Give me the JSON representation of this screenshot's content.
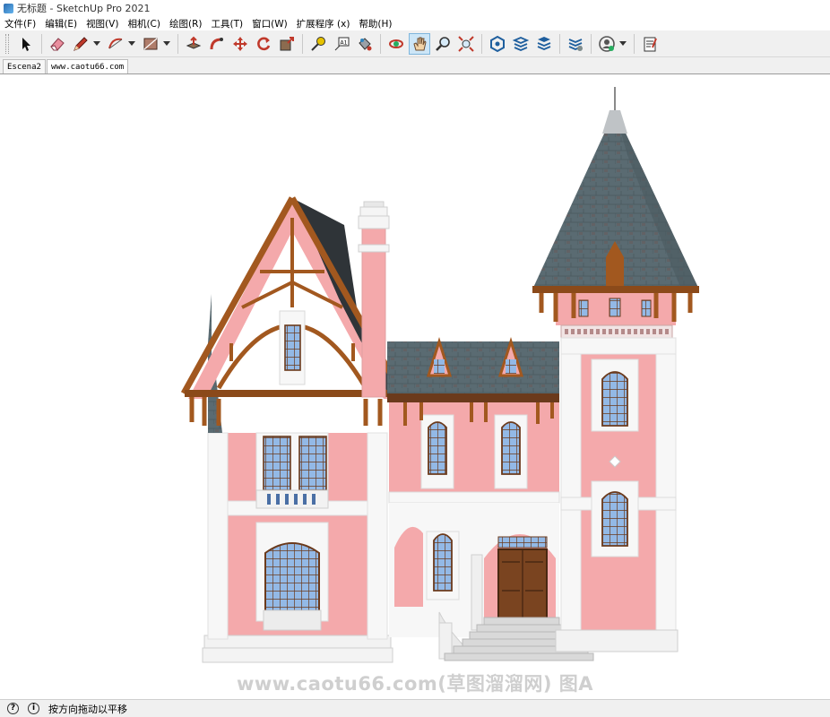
{
  "window": {
    "title": "无标题 - SketchUp Pro 2021"
  },
  "menu": [
    "文件(F)",
    "编辑(E)",
    "视图(V)",
    "相机(C)",
    "绘图(R)",
    "工具(T)",
    "窗口(W)",
    "扩展程序 (x)",
    "帮助(H)"
  ],
  "toolbar": {
    "groups": [
      [
        {
          "icon": "select-arrow-icon",
          "active": false
        }
      ],
      [
        {
          "icon": "eraser-icon"
        },
        {
          "icon": "pencil-line-icon",
          "dropdown": true
        },
        {
          "icon": "arc-icon",
          "dropdown": true
        },
        {
          "icon": "rectangle-icon",
          "dropdown": true
        }
      ],
      [
        {
          "icon": "push-pull-icon"
        },
        {
          "icon": "follow-me-icon"
        },
        {
          "icon": "move-icon"
        },
        {
          "icon": "rotate-icon"
        },
        {
          "icon": "scale-icon"
        }
      ],
      [
        {
          "icon": "tape-measure-icon"
        },
        {
          "icon": "text-icon"
        },
        {
          "icon": "paint-bucket-icon"
        }
      ],
      [
        {
          "icon": "orbit-icon"
        },
        {
          "icon": "pan-hand-icon",
          "active": true
        },
        {
          "icon": "zoom-icon"
        },
        {
          "icon": "zoom-extents-icon"
        }
      ],
      [
        {
          "icon": "warehouse-icon"
        },
        {
          "icon": "extension-warehouse-icon"
        },
        {
          "icon": "layout-send-icon"
        }
      ],
      [
        {
          "icon": "extension-manager-icon"
        }
      ],
      [
        {
          "icon": "account-icon",
          "dropdown": true
        }
      ],
      [
        {
          "icon": "report-icon"
        }
      ]
    ]
  },
  "scenes": {
    "tabs": [
      "Escena2",
      "www.caotu66.com"
    ],
    "active": 1
  },
  "viewport": {
    "watermark": "www.caotu66.com(草图溜溜网) 图A"
  },
  "status": {
    "info_icon": "i",
    "message": "按方向拖动以平移"
  },
  "colors": {
    "wall_pink": "#f4a9ab",
    "trim_white": "#f7f7f7",
    "roof_slate": "#5b6d74",
    "timber": "#a2581f",
    "window_blue": "#8fb7e6"
  }
}
